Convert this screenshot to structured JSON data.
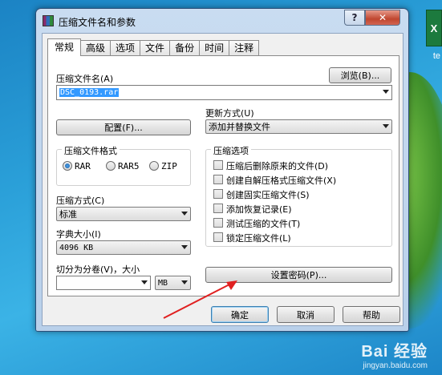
{
  "window": {
    "title": "压缩文件名和参数",
    "help_button": "?",
    "close_button": "✕"
  },
  "tabs": [
    "常规",
    "高级",
    "选项",
    "文件",
    "备份",
    "时间",
    "注释"
  ],
  "archive_name": {
    "label": "压缩文件名(A)",
    "value": "DSC_0193.rar",
    "browse_button": "浏览(B)..."
  },
  "profile_button": "配置(F)...",
  "update_mode": {
    "label": "更新方式(U)",
    "value": "添加并替换文件"
  },
  "archive_format": {
    "label": "压缩文件格式",
    "options": [
      "RAR",
      "RAR5",
      "ZIP"
    ],
    "selected": "RAR"
  },
  "compression_method": {
    "label": "压缩方式(C)",
    "value": "标准"
  },
  "dictionary_size": {
    "label": "字典大小(I)",
    "value": "4096 KB"
  },
  "split_volumes": {
    "label": "切分为分卷(V)，大小",
    "value": "",
    "unit": "MB"
  },
  "archiving_options": {
    "label": "压缩选项",
    "items": [
      {
        "label": "压缩后删除原来的文件(D)",
        "checked": false
      },
      {
        "label": "创建自解压格式压缩文件(X)",
        "checked": false
      },
      {
        "label": "创建固实压缩文件(S)",
        "checked": false
      },
      {
        "label": "添加恢复记录(E)",
        "checked": false
      },
      {
        "label": "测试压缩的文件(T)",
        "checked": false
      },
      {
        "label": "锁定压缩文件(L)",
        "checked": false
      }
    ]
  },
  "set_password_button": "设置密码(P)...",
  "footer": {
    "ok": "确定",
    "cancel": "取消",
    "help": "帮助"
  },
  "desktop": {
    "icon_letter": "X",
    "icon_label": "te",
    "watermark_main": "Bai 经验",
    "watermark_sub": "jingyan.baidu.com"
  },
  "colors": {
    "selection": "#3399ff",
    "arrow": "#e02020",
    "desktop": "#2a9fd8"
  }
}
